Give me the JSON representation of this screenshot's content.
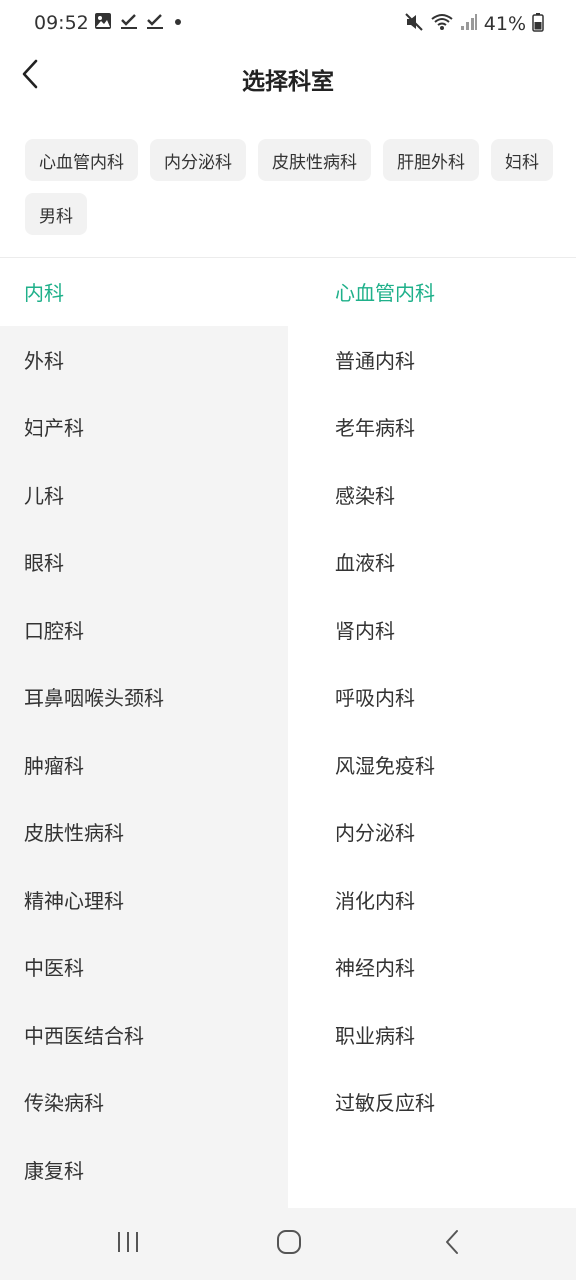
{
  "status_bar": {
    "time": "09:52",
    "battery_percent": "41%",
    "left_icons": [
      "image-icon",
      "check-icon",
      "check-icon",
      "dot-icon"
    ],
    "right_icons": [
      "mute-icon",
      "wifi-icon",
      "signal-icon",
      "battery-icon"
    ]
  },
  "header": {
    "title": "选择科室",
    "back_icon": "chevron-left-icon"
  },
  "quick_chips": [
    "心血管内科",
    "内分泌科",
    "皮肤性病科",
    "肝胆外科",
    "妇科",
    "男科"
  ],
  "categories": {
    "selected_index": 0,
    "items": [
      "内科",
      "外科",
      "妇产科",
      "儿科",
      "眼科",
      "口腔科",
      "耳鼻咽喉头颈科",
      "肿瘤科",
      "皮肤性病科",
      "精神心理科",
      "中医科",
      "中西医结合科",
      "传染病科",
      "康复科"
    ]
  },
  "subdepartments": {
    "selected_index": 0,
    "items": [
      "心血管内科",
      "普通内科",
      "老年病科",
      "感染科",
      "血液科",
      "肾内科",
      "呼吸内科",
      "风湿免疫科",
      "内分泌科",
      "消化内科",
      "神经内科",
      "职业病科",
      "过敏反应科"
    ]
  },
  "nav_bar": {
    "icons": [
      "recent-apps-icon",
      "home-icon",
      "back-icon"
    ]
  },
  "colors": {
    "accent": "#1fb08a",
    "left_panel_bg": "#f4f4f4",
    "chip_bg": "#f2f2f2"
  }
}
